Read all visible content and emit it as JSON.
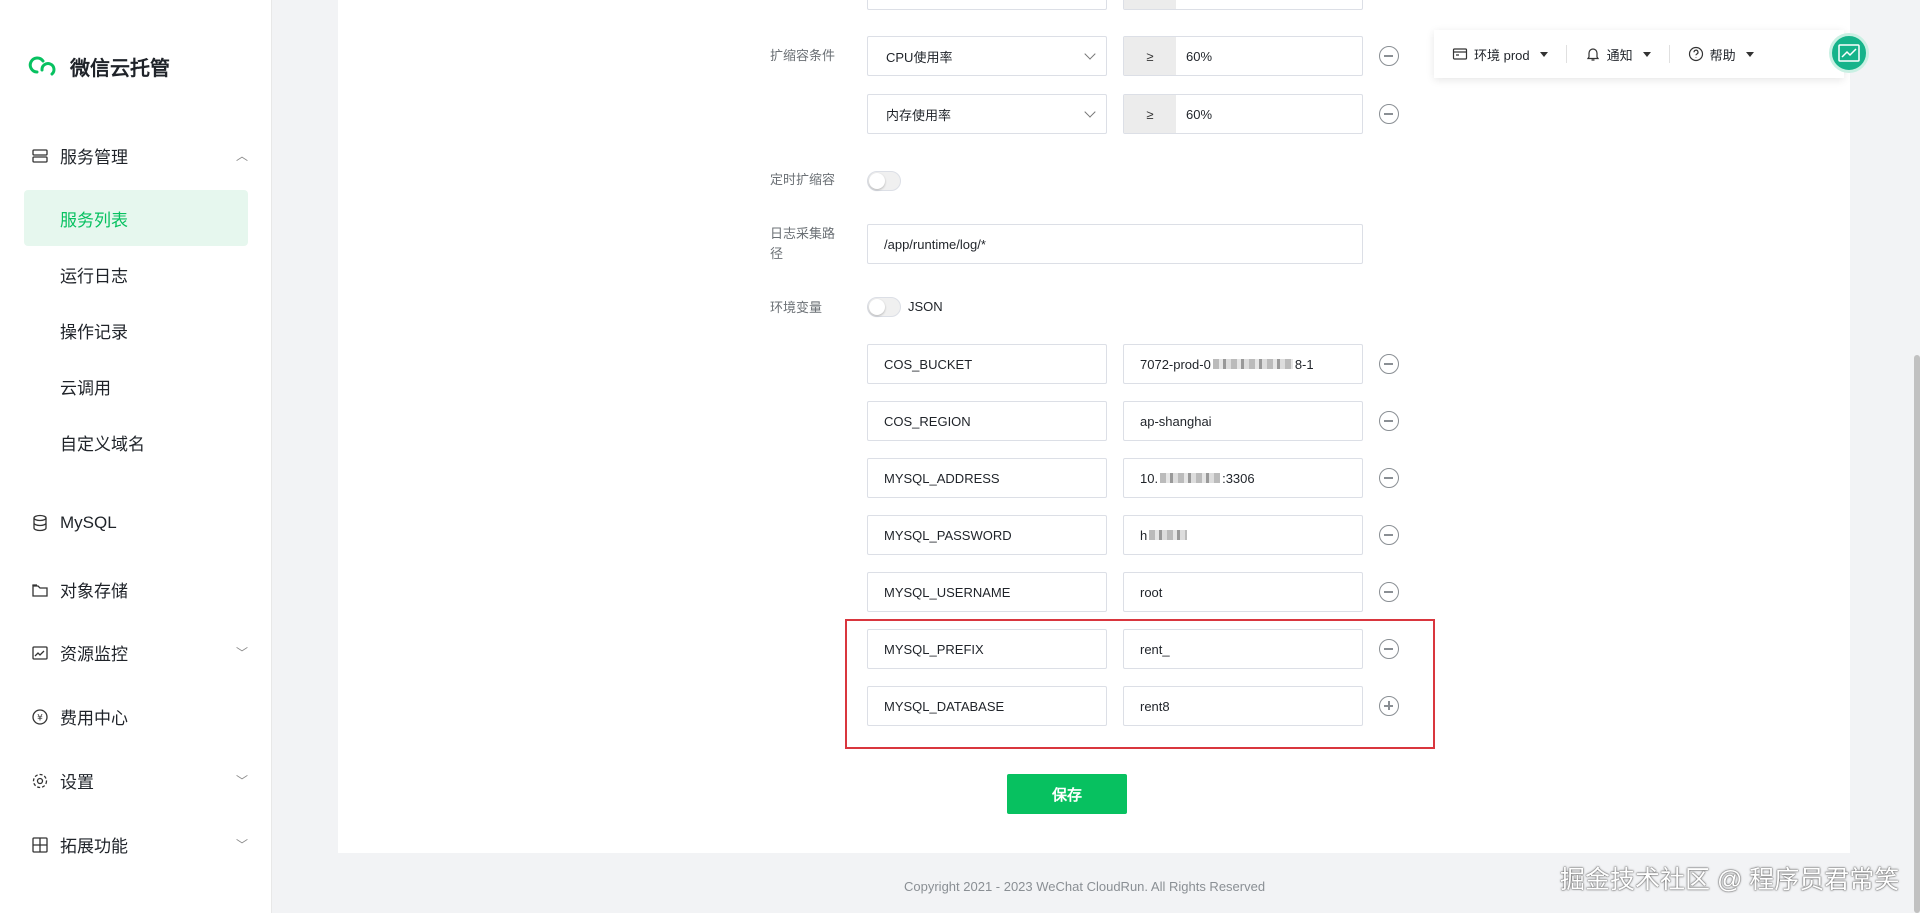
{
  "brand": {
    "name": "微信云托管"
  },
  "sidebar": {
    "service_mgmt": {
      "label": "服务管理",
      "items": [
        {
          "label": "服务列表"
        },
        {
          "label": "运行日志"
        },
        {
          "label": "操作记录"
        },
        {
          "label": "云调用"
        },
        {
          "label": "自定义域名"
        }
      ]
    },
    "mysql": {
      "label": "MySQL"
    },
    "object_storage": {
      "label": "对象存储"
    },
    "resource_monitor": {
      "label": "资源监控"
    },
    "billing": {
      "label": "费用中心"
    },
    "settings": {
      "label": "设置"
    },
    "extensions": {
      "label": "拓展功能"
    }
  },
  "topbar": {
    "env_label": "环境 prod",
    "notify_label": "通知",
    "help_label": "帮助"
  },
  "form": {
    "scale_condition_label": "扩缩容条件",
    "conditions": [
      {
        "metric": "CPU使用率",
        "op": "≥",
        "value": "60%"
      },
      {
        "metric": "内存使用率",
        "op": "≥",
        "value": "60%"
      }
    ],
    "scheduled_scaling_label": "定时扩缩容",
    "log_path_label": "日志采集路径",
    "log_path_value": "/app/runtime/log/*",
    "env_vars_label": "环境变量",
    "json_toggle_label": "JSON",
    "env_vars": [
      {
        "key": "COS_BUCKET",
        "value_prefix": "7072-prod-0",
        "value_suffix": "8-1",
        "masked": true
      },
      {
        "key": "COS_REGION",
        "value": "ap-shanghai"
      },
      {
        "key": "MYSQL_ADDRESS",
        "value_prefix": "10.",
        "value_suffix": ":3306",
        "masked": true
      },
      {
        "key": "MYSQL_PASSWORD",
        "value_prefix": "h",
        "value_suffix": "",
        "masked": true
      },
      {
        "key": "MYSQL_USERNAME",
        "value": "root"
      },
      {
        "key": "MYSQL_PREFIX",
        "value": "rent_"
      },
      {
        "key": "MYSQL_DATABASE",
        "value": "rent8"
      }
    ],
    "save_label": "保存"
  },
  "footer": {
    "copyright": "Copyright 2021 - 2023 WeChat CloudRun. All Rights Reserved"
  },
  "watermark": "掘金技术社区 @ 程序员君常笑",
  "colors": {
    "accent": "#07c160",
    "highlight": "#d9363e"
  }
}
